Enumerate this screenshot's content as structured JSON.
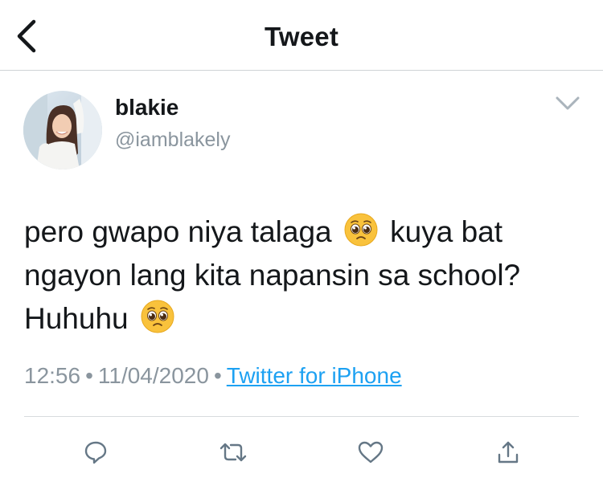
{
  "header": {
    "title": "Tweet",
    "back_icon": "chevron-left-icon"
  },
  "tweet": {
    "display_name": "blakie",
    "handle": "@iamblakely",
    "text_parts": {
      "p1": "pero gwapo niya talaga ",
      "emoji": "pleading-face-emoji",
      "p2": " kuya bat ngayon lang kita napansin sa school? Huhuhu "
    },
    "time": "12:56",
    "separator": "•",
    "date": "11/04/2020",
    "source": "Twitter for iPhone"
  },
  "actions": {
    "reply_icon": "reply-icon",
    "retweet_icon": "retweet-icon",
    "like_icon": "heart-icon",
    "share_icon": "share-icon"
  },
  "colors": {
    "link": "#1da1f2",
    "icon": "#657786",
    "secondary_text": "#8a959e",
    "divider": "#d7dbde"
  }
}
